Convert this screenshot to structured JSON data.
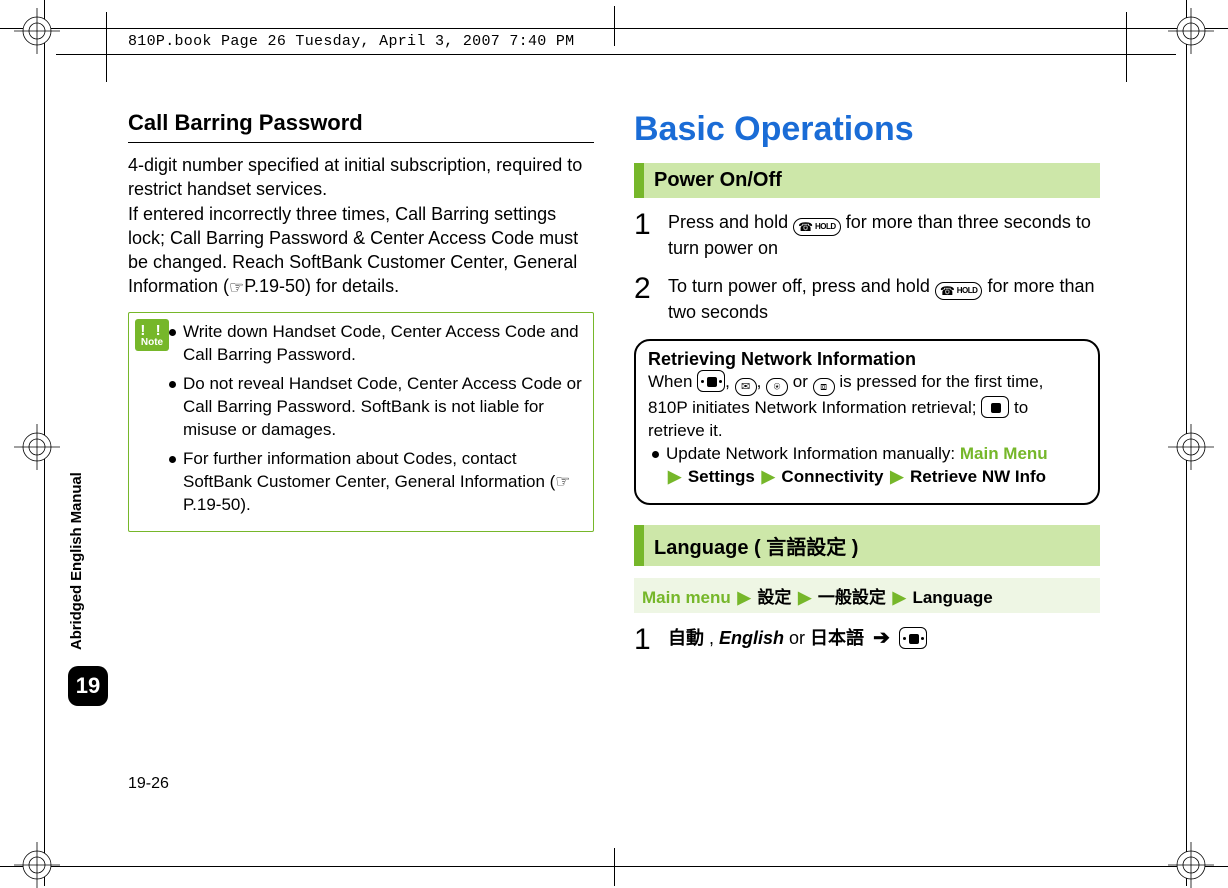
{
  "print_header": "810P.book  Page 26  Tuesday, April 3, 2007  7:40 PM",
  "sidebar": {
    "label": "Abridged English Manual",
    "chapter": "19"
  },
  "footer_page": "19-26",
  "left": {
    "heading": "Call Barring Password",
    "body1": "4-digit number specified at initial subscription, required to restrict handset services.",
    "body2_a": "If entered incorrectly three times, Call Barring settings lock; Call Barring Password & Center Access Code must be changed. Reach SoftBank Customer Center, General Information (",
    "body2_ref": "P.19-50",
    "body2_b": ") for details.",
    "note": {
      "badge": "Note",
      "items": [
        "Write down Handset Code, Center Access Code and Call Barring Password.",
        "Do not reveal Handset Code, Center Access Code or Call Barring Password. SoftBank is not liable for misuse or damages.",
        "For further information about Codes, contact SoftBank Customer Center, General Information (☞P.19-50)."
      ]
    }
  },
  "right": {
    "title": "Basic Operations",
    "power": {
      "heading": "Power On/Off",
      "step1_a": "Press and hold ",
      "step1_b": " for more than three seconds to turn power on",
      "step2_a": "To turn power off, press and hold ",
      "step2_b": " for more than two seconds"
    },
    "netbox": {
      "title": "Retrieving Network Information",
      "line1_a": "When ",
      "line1_b": " is pressed for the first time, 810P initiates Network Information retrieval; ",
      "line1_c": " to retrieve it.",
      "bullet_a": "Update Network Information manually: ",
      "menu": {
        "root": "Main Menu",
        "a": "Settings",
        "b": "Connectivity",
        "c": "Retrieve NW Info"
      },
      "sep_or": " or ",
      "sep_comma": ", "
    },
    "lang": {
      "heading": "Language ( 言語設定 )",
      "path": {
        "root": "Main menu",
        "a": "設定",
        "b": "一般設定",
        "c": "Language"
      },
      "step1": {
        "opt1": "自動",
        "sep1": " , ",
        "opt2": "English",
        "sep2": " or ",
        "opt3": "日本語"
      }
    }
  },
  "icons": {
    "power_key": "power-end-key",
    "nav_key": "nav-center-key",
    "mail_key": "mail-key",
    "web_key": "web-key",
    "tv_key": "tv-key",
    "pointer": "☞"
  }
}
